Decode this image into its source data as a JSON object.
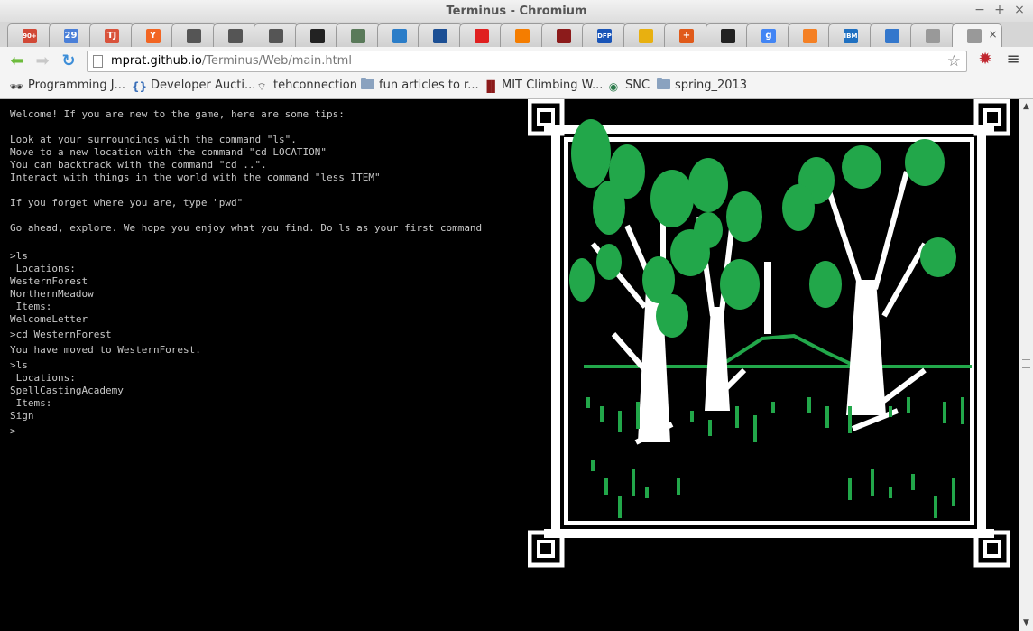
{
  "window": {
    "title": "Terminus - Chromium",
    "minimize": "−",
    "maximize": "+",
    "close": "×"
  },
  "tabs": [
    {
      "icon": "gmail-icon",
      "badge": "90+",
      "color": "#d14836"
    },
    {
      "icon": "calendar-icon",
      "badge": "29",
      "color": "#4a7fd8"
    },
    {
      "icon": "tj-icon",
      "badge": "TJ",
      "color": "#d9533c"
    },
    {
      "icon": "ycombinator-icon",
      "badge": "Y",
      "color": "#f26522"
    },
    {
      "icon": "eraser-icon",
      "badge": "",
      "color": "#555555"
    },
    {
      "icon": "eraser-icon",
      "badge": "",
      "color": "#555555"
    },
    {
      "icon": "eraser-icon",
      "badge": "",
      "color": "#555555"
    },
    {
      "icon": "texas-instruments-icon",
      "badge": "",
      "color": "#222222"
    },
    {
      "icon": "target-icon",
      "badge": "",
      "color": "#5a7a5a"
    },
    {
      "icon": "drupal-icon",
      "badge": "",
      "color": "#2b7dc8"
    },
    {
      "icon": "atlas-icon",
      "badge": "",
      "color": "#1c4f94"
    },
    {
      "icon": "spark-icon",
      "badge": "",
      "color": "#e02020"
    },
    {
      "icon": "blogger-icon",
      "badge": "",
      "color": "#f57d00"
    },
    {
      "icon": "mit-icon",
      "badge": "",
      "color": "#8c1b1b"
    },
    {
      "icon": "dfp-icon",
      "badge": "DFP",
      "color": "#1a55b8"
    },
    {
      "icon": "smiley-icon",
      "badge": "",
      "color": "#e8b010"
    },
    {
      "icon": "plus-icon",
      "badge": "+",
      "color": "#e05a1a"
    },
    {
      "icon": "github-icon",
      "badge": "",
      "color": "#222222"
    },
    {
      "icon": "google-icon",
      "badge": "g",
      "color": "#4285f4"
    },
    {
      "icon": "stackoverflow-icon",
      "badge": "",
      "color": "#f48024"
    },
    {
      "icon": "ibm-icon",
      "badge": "IBM",
      "color": "#1f70c1"
    },
    {
      "icon": "link-icon",
      "badge": "",
      "color": "#3377cc"
    },
    {
      "icon": "page-icon",
      "badge": "",
      "color": "#999999"
    },
    {
      "icon": "page-icon",
      "badge": "",
      "color": "#999999",
      "active": true
    }
  ],
  "toolbar": {
    "url_host": "mprat.github.io",
    "url_path": "/Terminus/Web/main.html",
    "back": "⬅",
    "forward": "➡",
    "reload": "↻",
    "star": "☆",
    "menu": "≡",
    "ext": "✹"
  },
  "bookmarks": [
    {
      "label": "Programming J...",
      "icon": "spy-icon",
      "glyph": "🕶"
    },
    {
      "label": "Developer Aucti...",
      "icon": "braces-icon",
      "glyph": "{}"
    },
    {
      "label": "tehconnection",
      "icon": "wifi-icon",
      "glyph": "⌔"
    },
    {
      "label": "fun articles to r...",
      "icon": "folder-icon",
      "glyph": ""
    },
    {
      "label": "MIT Climbing W...",
      "icon": "mit-icon",
      "glyph": "▐▌"
    },
    {
      "label": "SNC",
      "icon": "snc-icon",
      "glyph": "◉"
    },
    {
      "label": "spring_2013",
      "icon": "folder-icon",
      "glyph": ""
    }
  ],
  "terminal": {
    "intro": [
      "Welcome! If you are new to the game, here are some tips:",
      "",
      "Look at your surroundings with the command \"ls\".",
      "Move to a new location with the command \"cd LOCATION\"",
      "You can backtrack with the command \"cd ..\".",
      "Interact with things in the world with the command \"less ITEM\"",
      "",
      "If you forget where you are, type \"pwd\"",
      "",
      "Go ahead, explore. We hope you enjoy what you find. Do ls as your first command"
    ],
    "session": [
      ">ls",
      " Locations:",
      "WesternForest",
      "NorthernMeadow",
      " Items:",
      "WelcomeLetter",
      ">cd WesternForest",
      "You have moved to WesternForest.",
      ">ls",
      " Locations:",
      "SpellCastingAcademy",
      " Items:",
      "Sign",
      ">"
    ]
  },
  "colors": {
    "leaf": "#22a74a",
    "trunk": "#ffffff",
    "background": "#000000",
    "text": "#c8c8c8"
  }
}
